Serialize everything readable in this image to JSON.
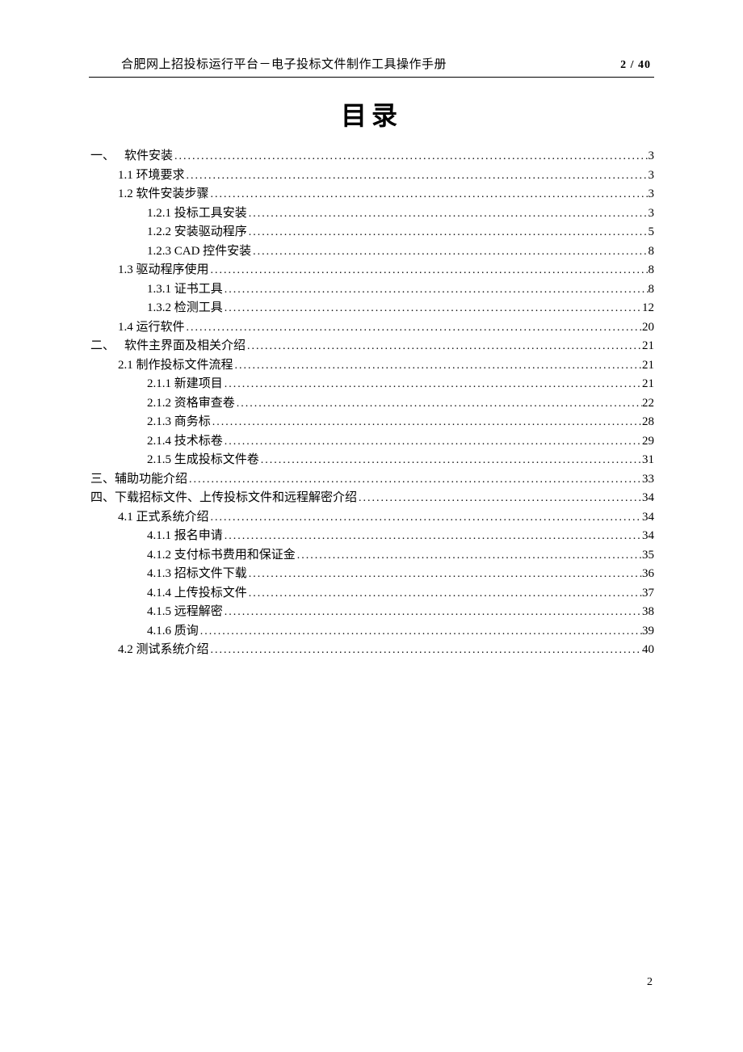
{
  "header": {
    "title": "合肥网上招投标运行平台－电子投标文件制作工具操作手册",
    "page_indicator": "2 / 40"
  },
  "toc_title": "目录",
  "toc": [
    {
      "level": 0,
      "prefix": "一、",
      "label": "软件安装",
      "page": "3",
      "gap": true
    },
    {
      "level": 1,
      "prefix": "1.1",
      "label": " 环境要求",
      "page": "3"
    },
    {
      "level": 1,
      "prefix": "1.2",
      "label": " 软件安装步骤",
      "page": "3"
    },
    {
      "level": 2,
      "prefix": "1.2.1",
      "label": " 投标工具安装",
      "page": "3"
    },
    {
      "level": 2,
      "prefix": "1.2.2",
      "label": " 安装驱动程序",
      "page": "5"
    },
    {
      "level": 2,
      "prefix": "1.2.3",
      "label": " CAD 控件安装",
      "page": "8"
    },
    {
      "level": 1,
      "prefix": "1.3",
      "label": " 驱动程序使用",
      "page": "8"
    },
    {
      "level": 2,
      "prefix": "1.3.1",
      "label": " 证书工具",
      "page": "8"
    },
    {
      "level": 2,
      "prefix": "1.3.2",
      "label": " 检测工具",
      "page": "12"
    },
    {
      "level": 1,
      "prefix": "1.4",
      "label": " 运行软件",
      "page": "20"
    },
    {
      "level": 0,
      "prefix": "二、",
      "label": "软件主界面及相关介绍",
      "page": "21",
      "gap": true
    },
    {
      "level": 1,
      "prefix": "2.1",
      "label": " 制作投标文件流程",
      "page": "21"
    },
    {
      "level": 2,
      "prefix": "2.1.1",
      "label": "  新建项目",
      "page": "21"
    },
    {
      "level": 2,
      "prefix": "2.1.2",
      "label": "  资格审查卷",
      "page": "22"
    },
    {
      "level": 2,
      "prefix": "2.1.3",
      "label": "  商务标",
      "page": "28"
    },
    {
      "level": 2,
      "prefix": "2.1.4",
      "label": "  技术标卷",
      "page": "29"
    },
    {
      "level": 2,
      "prefix": "2.1.5",
      "label": "  生成投标文件卷",
      "page": "31"
    },
    {
      "level": 0,
      "prefix": "三、",
      "label": "辅助功能介绍",
      "page": "33"
    },
    {
      "level": 0,
      "prefix": "四、",
      "label": "下载招标文件、上传投标文件和远程解密介绍",
      "page": "34"
    },
    {
      "level": 1,
      "prefix": "4.1",
      "label": "  正式系统介绍",
      "page": "34"
    },
    {
      "level": 2,
      "prefix": "4.1.1",
      "label": "  报名申请",
      "page": "34"
    },
    {
      "level": 2,
      "prefix": "4.1.2",
      "label": "  支付标书费用和保证金",
      "page": "35"
    },
    {
      "level": 2,
      "prefix": "4.1.3",
      "label": "  招标文件下载",
      "page": "36"
    },
    {
      "level": 2,
      "prefix": "4.1.4",
      "label": "  上传投标文件",
      "page": "37"
    },
    {
      "level": 2,
      "prefix": "4.1.5",
      "label": "  远程解密",
      "page": "38"
    },
    {
      "level": 2,
      "prefix": "4.1.6",
      "label": "  质询",
      "page": "39"
    },
    {
      "level": 1,
      "prefix": "4.2",
      "label": "  测试系统介绍",
      "page": "40"
    }
  ],
  "footer": {
    "page_number": "2"
  }
}
